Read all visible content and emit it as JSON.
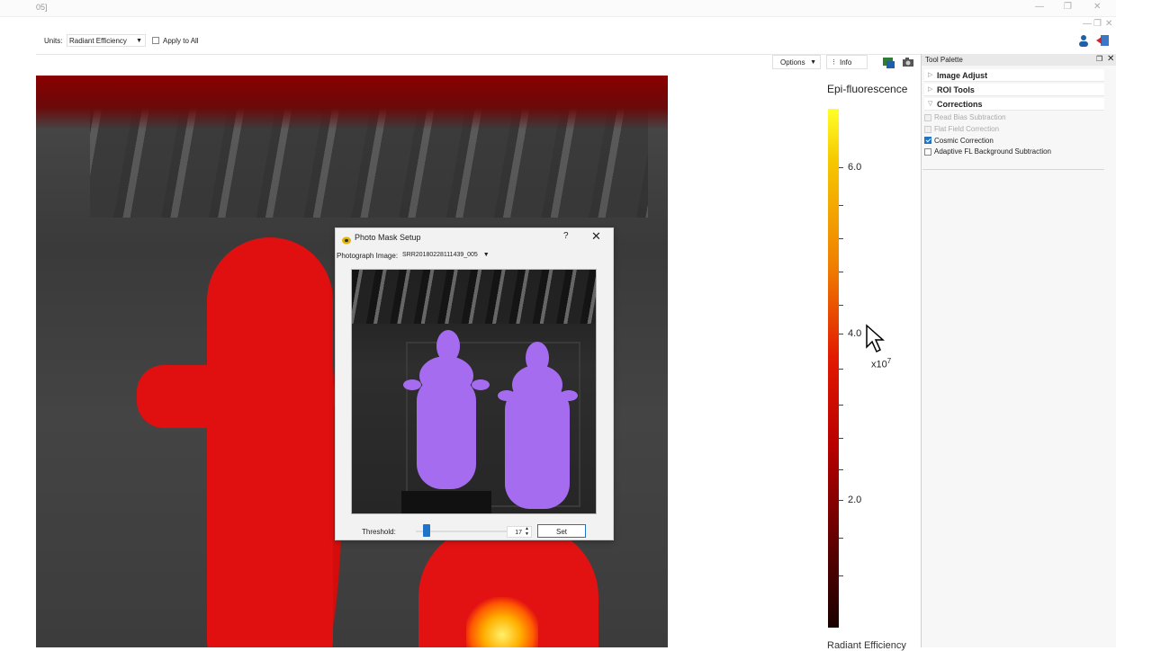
{
  "window": {
    "title": "05]",
    "minimize_icon": "minimize-icon",
    "restore_icon": "restore-icon",
    "close_icon": "close-icon"
  },
  "toolbar": {
    "units_label": "Units:",
    "units_value": "Radiant Efficiency",
    "apply_all_label": "Apply to All",
    "apply_all_checked": false
  },
  "view_header": {
    "options_label": "Options",
    "info_label": "Info"
  },
  "dialog": {
    "title": "Photo Mask Setup",
    "help": "?",
    "close": "✕",
    "photo_label": "Photograph Image:",
    "photo_value": "SRR20180228111439_005",
    "threshold_label": "Threshold:",
    "threshold_value": "17",
    "threshold_level": 0.17,
    "set_label": "Set"
  },
  "colorbar": {
    "title": "Epi-fluorescence",
    "ticks": [
      "6.0",
      "4.0",
      "2.0"
    ],
    "exponent_base": "x10",
    "exponent": "7",
    "bottom_label": "Radiant Efficiency"
  },
  "tool_palette": {
    "title": "Tool Palette",
    "sections": [
      {
        "label": "Image Adjust",
        "expanded": false
      },
      {
        "label": "ROI Tools",
        "expanded": false
      },
      {
        "label": "Corrections",
        "expanded": true
      }
    ],
    "corrections": [
      {
        "label": "Read Bias Subtraction",
        "checked": false,
        "disabled": true
      },
      {
        "label": "Flat Field Correction",
        "checked": false,
        "disabled": true
      },
      {
        "label": "Cosmic Correction",
        "checked": true,
        "disabled": false
      },
      {
        "label": "Adaptive FL Background Subtraction",
        "checked": false,
        "disabled": false
      }
    ]
  },
  "colors": {
    "accent": "#1f73c9",
    "mask_purple": "#a56cf0",
    "overlay_red": "#e01010"
  }
}
